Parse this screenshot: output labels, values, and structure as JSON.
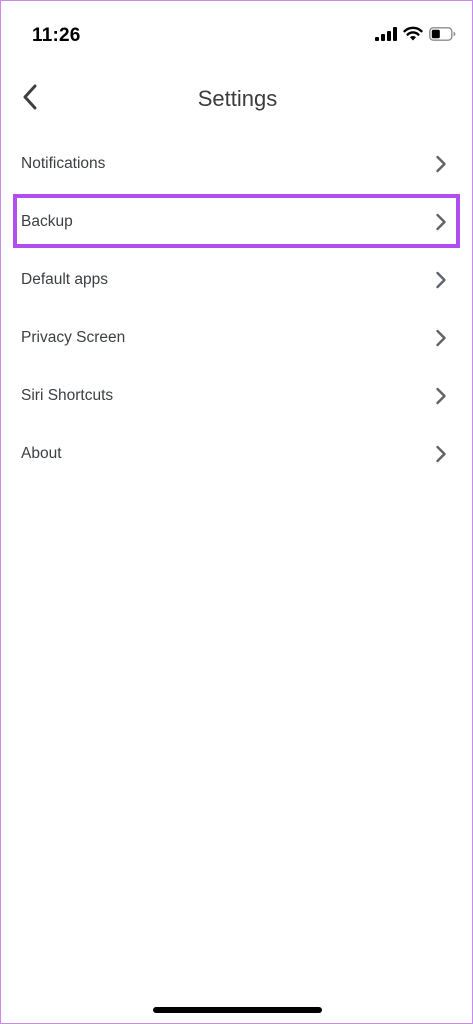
{
  "status_bar": {
    "time": "11:26",
    "icons": [
      "cellular-signal-icon",
      "wifi-icon",
      "battery-icon"
    ]
  },
  "header": {
    "title": "Settings",
    "back_icon": "chevron-left-icon"
  },
  "settings": {
    "items": [
      {
        "label": "Notifications"
      },
      {
        "label": "Backup"
      },
      {
        "label": "Default apps"
      },
      {
        "label": "Privacy Screen"
      },
      {
        "label": "Siri Shortcuts"
      },
      {
        "label": "About"
      }
    ]
  },
  "colors": {
    "highlight": "#b14ef0",
    "text": "#3c4043",
    "chevron": "#5f6368"
  }
}
